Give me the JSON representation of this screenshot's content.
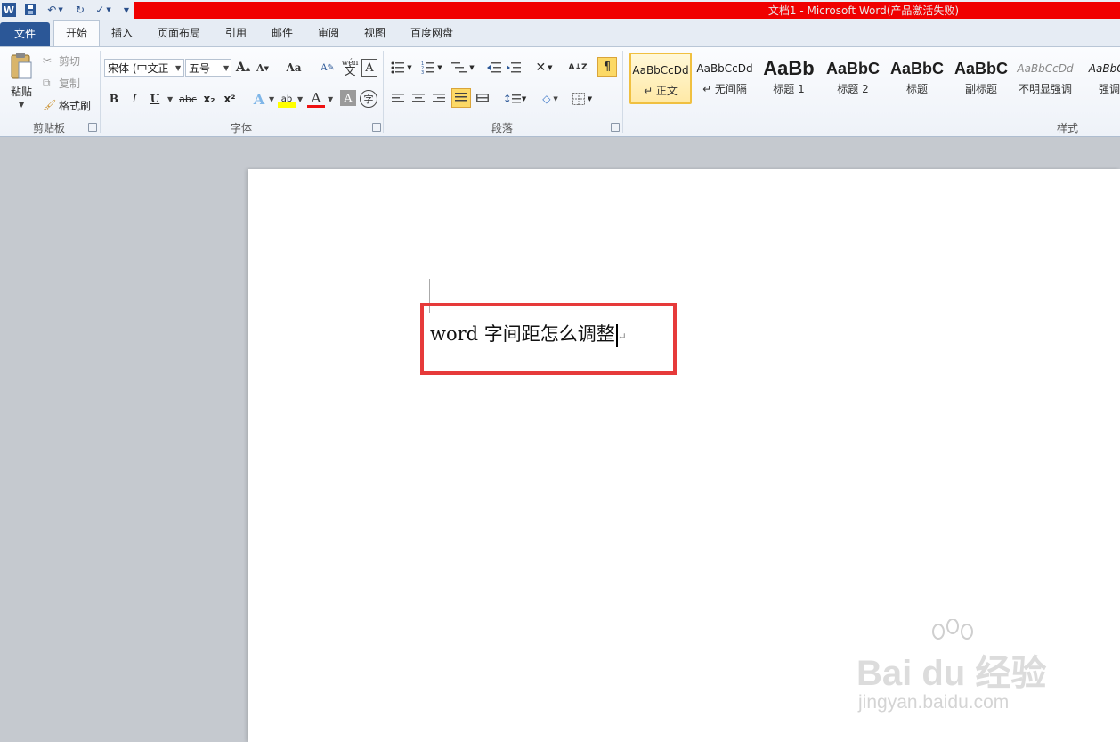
{
  "window": {
    "title": "文档1 - Microsoft Word(产品激活失败)"
  },
  "quick_access": {
    "icons": [
      "word-logo-icon",
      "save-icon",
      "undo-icon",
      "redo-icon",
      "spellcheck-icon",
      "customize-icon"
    ]
  },
  "tabs": [
    "文件",
    "开始",
    "插入",
    "页面布局",
    "引用",
    "邮件",
    "审阅",
    "视图",
    "百度网盘"
  ],
  "clipboard": {
    "paste": "粘贴",
    "cut": "剪切",
    "copy": "复制",
    "format_painter": "格式刷",
    "group": "剪贴板"
  },
  "font": {
    "name": "宋体 (中文正",
    "size": "五号",
    "group": "字体",
    "change_case": "Aa",
    "wen": "wén",
    "bold": "B",
    "italic": "I",
    "underline": "U",
    "strike": "abc",
    "sub": "x₂",
    "sup": "x²",
    "border_char": "A",
    "circle_char": "字"
  },
  "paragraph": {
    "group": "段落"
  },
  "styles": {
    "group": "样式",
    "items": [
      {
        "sample": "AaBbCcDd",
        "name": "↵ 正文"
      },
      {
        "sample": "AaBbCcDd",
        "name": "↵ 无间隔"
      },
      {
        "sample": "AaBb",
        "name": "标题 1"
      },
      {
        "sample": "AaBbC",
        "name": "标题 2"
      },
      {
        "sample": "AaBbC",
        "name": "标题"
      },
      {
        "sample": "AaBbC",
        "name": "副标题"
      },
      {
        "sample": "AaBbCcDd",
        "name": "不明显强调"
      },
      {
        "sample": "AaBbCc",
        "name": "强调"
      }
    ]
  },
  "document": {
    "text": "word 字间距怎么调整"
  },
  "watermark": {
    "brand": "Bai du 经验",
    "url": "jingyan.baidu.com"
  },
  "colors": {
    "file_tab": "#2b5797",
    "title_red": "#f00000",
    "highlight_box": "#e63a3a",
    "canvas": "#c5c9cf"
  }
}
